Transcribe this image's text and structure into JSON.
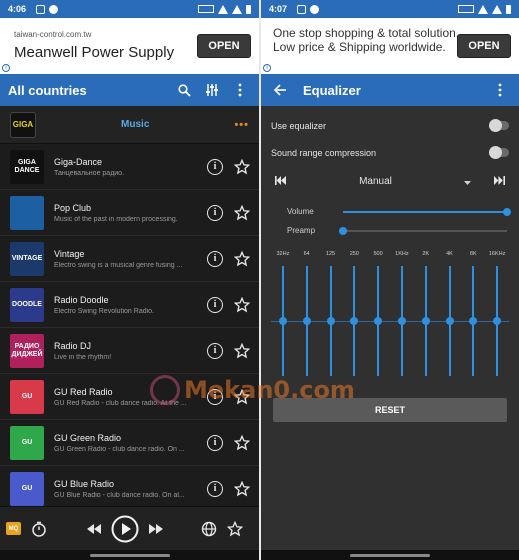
{
  "left": {
    "status": {
      "time": "4:06"
    },
    "ad": {
      "url": "taiwan-control.com.tw",
      "title": "Meanwell Power Supply",
      "button": "OPEN"
    },
    "appbar": {
      "title": "All countries"
    },
    "category": {
      "logo_text": "GIGA",
      "label": "Music",
      "more": "•••"
    },
    "stations": [
      {
        "name": "Giga-Dance",
        "desc": "Танцевальное радио.",
        "logo_text": "GIGA DANCE",
        "logo_color": "#111111"
      },
      {
        "name": "Pop Club",
        "desc": "Music of the past in modern processing.",
        "logo_text": "",
        "logo_color": "#1d5fa3"
      },
      {
        "name": "Vintage",
        "desc": "Electro swing is a musical genre fusing ...",
        "logo_text": "VINTAGE",
        "logo_color": "#1b3a6b"
      },
      {
        "name": "Radio Doodle",
        "desc": "Electro Swing Revolution Radio.",
        "logo_text": "DOODLE",
        "logo_color": "#2b3a8a"
      },
      {
        "name": "Radio DJ",
        "desc": "Live in the rhythm!",
        "logo_text": "РАДИО ДИДЖЕЙ",
        "logo_color": "#b0205a"
      },
      {
        "name": "GU Red Radio",
        "desc": "GU Red Radio - club dance radio. At the ...",
        "logo_text": "GU",
        "logo_color": "#d93a4a"
      },
      {
        "name": "GU Green Radio",
        "desc": "GU Green Radio - club dance radio. On ...",
        "logo_text": "GU",
        "logo_color": "#2ea84a"
      },
      {
        "name": "GU Blue Radio",
        "desc": "GU Blue Radio - club dance radio. On al...",
        "logo_text": "GU",
        "logo_color": "#4a5acb"
      }
    ],
    "player": {
      "quality": "MQ"
    }
  },
  "right": {
    "status": {
      "time": "4:07"
    },
    "ad": {
      "text": "One stop shopping & total solution. Low price & Shipping worldwide.",
      "button": "OPEN"
    },
    "appbar": {
      "title": "Equalizer"
    },
    "settings": [
      {
        "label": "Use equalizer",
        "on": false
      },
      {
        "label": "Sound range compression",
        "on": false
      }
    ],
    "preset": "Manual",
    "volume": {
      "label": "Volume",
      "level": 1.0
    },
    "preamp": {
      "label": "Preamp",
      "level": 0.0
    },
    "bands": [
      {
        "label": "32Hz",
        "level": 0.5
      },
      {
        "label": "64",
        "level": 0.5
      },
      {
        "label": "125",
        "level": 0.5
      },
      {
        "label": "250",
        "level": 0.5
      },
      {
        "label": "500",
        "level": 0.5
      },
      {
        "label": "1KHz",
        "level": 0.5
      },
      {
        "label": "2K",
        "level": 0.5
      },
      {
        "label": "4K",
        "level": 0.5
      },
      {
        "label": "8K",
        "level": 0.5
      },
      {
        "label": "16KHz",
        "level": 0.5
      }
    ],
    "reset_label": "RESET"
  },
  "watermark": {
    "text": "Mekan0.com"
  },
  "colors": {
    "appbar": "#2a6cb8",
    "accent": "#2f8fe0",
    "more_dots": "#e08b1a",
    "category_label": "#5aa9e6"
  }
}
